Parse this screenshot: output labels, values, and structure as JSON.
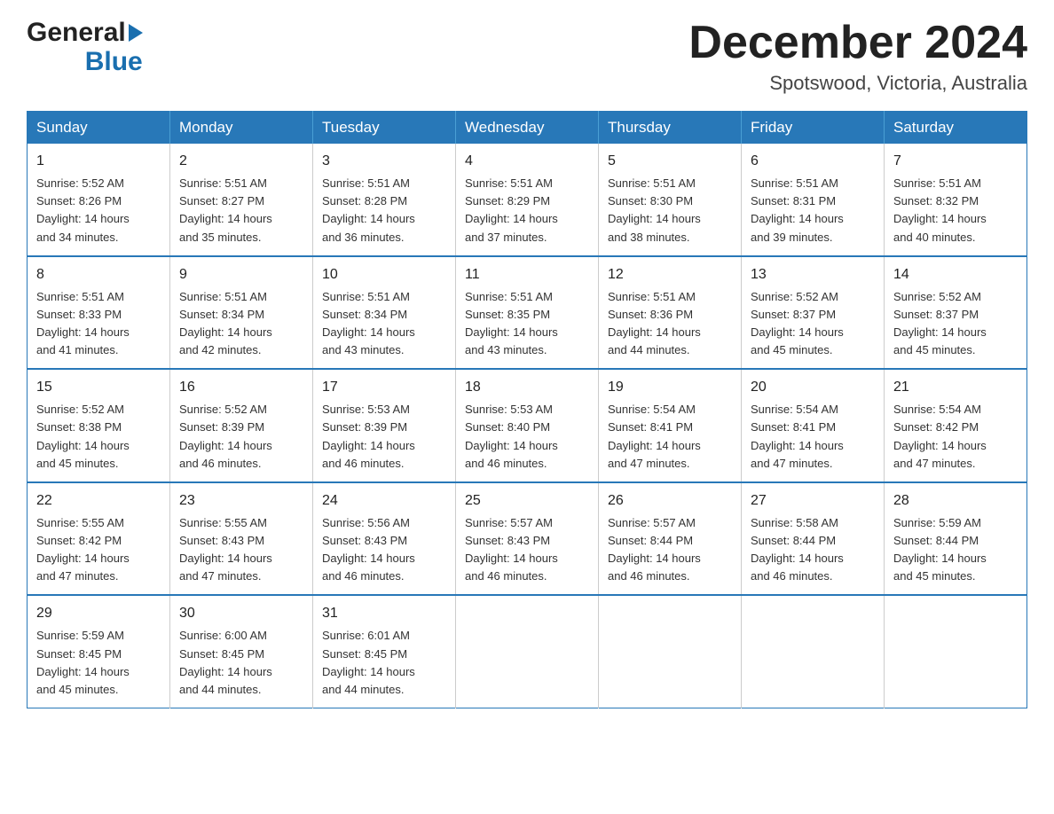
{
  "header": {
    "month_title": "December 2024",
    "location": "Spotswood, Victoria, Australia",
    "logo_line1": "General",
    "logo_line2": "Blue"
  },
  "days_of_week": [
    "Sunday",
    "Monday",
    "Tuesday",
    "Wednesday",
    "Thursday",
    "Friday",
    "Saturday"
  ],
  "weeks": [
    [
      {
        "day": "1",
        "sunrise": "5:52 AM",
        "sunset": "8:26 PM",
        "daylight": "14 hours and 34 minutes."
      },
      {
        "day": "2",
        "sunrise": "5:51 AM",
        "sunset": "8:27 PM",
        "daylight": "14 hours and 35 minutes."
      },
      {
        "day": "3",
        "sunrise": "5:51 AM",
        "sunset": "8:28 PM",
        "daylight": "14 hours and 36 minutes."
      },
      {
        "day": "4",
        "sunrise": "5:51 AM",
        "sunset": "8:29 PM",
        "daylight": "14 hours and 37 minutes."
      },
      {
        "day": "5",
        "sunrise": "5:51 AM",
        "sunset": "8:30 PM",
        "daylight": "14 hours and 38 minutes."
      },
      {
        "day": "6",
        "sunrise": "5:51 AM",
        "sunset": "8:31 PM",
        "daylight": "14 hours and 39 minutes."
      },
      {
        "day": "7",
        "sunrise": "5:51 AM",
        "sunset": "8:32 PM",
        "daylight": "14 hours and 40 minutes."
      }
    ],
    [
      {
        "day": "8",
        "sunrise": "5:51 AM",
        "sunset": "8:33 PM",
        "daylight": "14 hours and 41 minutes."
      },
      {
        "day": "9",
        "sunrise": "5:51 AM",
        "sunset": "8:34 PM",
        "daylight": "14 hours and 42 minutes."
      },
      {
        "day": "10",
        "sunrise": "5:51 AM",
        "sunset": "8:34 PM",
        "daylight": "14 hours and 43 minutes."
      },
      {
        "day": "11",
        "sunrise": "5:51 AM",
        "sunset": "8:35 PM",
        "daylight": "14 hours and 43 minutes."
      },
      {
        "day": "12",
        "sunrise": "5:51 AM",
        "sunset": "8:36 PM",
        "daylight": "14 hours and 44 minutes."
      },
      {
        "day": "13",
        "sunrise": "5:52 AM",
        "sunset": "8:37 PM",
        "daylight": "14 hours and 45 minutes."
      },
      {
        "day": "14",
        "sunrise": "5:52 AM",
        "sunset": "8:37 PM",
        "daylight": "14 hours and 45 minutes."
      }
    ],
    [
      {
        "day": "15",
        "sunrise": "5:52 AM",
        "sunset": "8:38 PM",
        "daylight": "14 hours and 45 minutes."
      },
      {
        "day": "16",
        "sunrise": "5:52 AM",
        "sunset": "8:39 PM",
        "daylight": "14 hours and 46 minutes."
      },
      {
        "day": "17",
        "sunrise": "5:53 AM",
        "sunset": "8:39 PM",
        "daylight": "14 hours and 46 minutes."
      },
      {
        "day": "18",
        "sunrise": "5:53 AM",
        "sunset": "8:40 PM",
        "daylight": "14 hours and 46 minutes."
      },
      {
        "day": "19",
        "sunrise": "5:54 AM",
        "sunset": "8:41 PM",
        "daylight": "14 hours and 47 minutes."
      },
      {
        "day": "20",
        "sunrise": "5:54 AM",
        "sunset": "8:41 PM",
        "daylight": "14 hours and 47 minutes."
      },
      {
        "day": "21",
        "sunrise": "5:54 AM",
        "sunset": "8:42 PM",
        "daylight": "14 hours and 47 minutes."
      }
    ],
    [
      {
        "day": "22",
        "sunrise": "5:55 AM",
        "sunset": "8:42 PM",
        "daylight": "14 hours and 47 minutes."
      },
      {
        "day": "23",
        "sunrise": "5:55 AM",
        "sunset": "8:43 PM",
        "daylight": "14 hours and 47 minutes."
      },
      {
        "day": "24",
        "sunrise": "5:56 AM",
        "sunset": "8:43 PM",
        "daylight": "14 hours and 46 minutes."
      },
      {
        "day": "25",
        "sunrise": "5:57 AM",
        "sunset": "8:43 PM",
        "daylight": "14 hours and 46 minutes."
      },
      {
        "day": "26",
        "sunrise": "5:57 AM",
        "sunset": "8:44 PM",
        "daylight": "14 hours and 46 minutes."
      },
      {
        "day": "27",
        "sunrise": "5:58 AM",
        "sunset": "8:44 PM",
        "daylight": "14 hours and 46 minutes."
      },
      {
        "day": "28",
        "sunrise": "5:59 AM",
        "sunset": "8:44 PM",
        "daylight": "14 hours and 45 minutes."
      }
    ],
    [
      {
        "day": "29",
        "sunrise": "5:59 AM",
        "sunset": "8:45 PM",
        "daylight": "14 hours and 45 minutes."
      },
      {
        "day": "30",
        "sunrise": "6:00 AM",
        "sunset": "8:45 PM",
        "daylight": "14 hours and 44 minutes."
      },
      {
        "day": "31",
        "sunrise": "6:01 AM",
        "sunset": "8:45 PM",
        "daylight": "14 hours and 44 minutes."
      },
      null,
      null,
      null,
      null
    ]
  ],
  "labels": {
    "sunrise": "Sunrise:",
    "sunset": "Sunset:",
    "daylight": "Daylight:"
  }
}
